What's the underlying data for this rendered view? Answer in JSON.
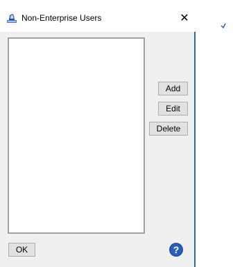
{
  "window": {
    "title": "Non-Enterprise Users",
    "close_label": "✕",
    "title_icon": "users-dialog-icon",
    "accent_color": "#2e64a9"
  },
  "users_list": {
    "items": []
  },
  "actions": {
    "add_label": "Add",
    "edit_label": "Edit",
    "delete_label": "Delete"
  },
  "footer": {
    "ok_label": "OK",
    "help_icon": "help-icon",
    "help_color": "#1f4fa0"
  }
}
